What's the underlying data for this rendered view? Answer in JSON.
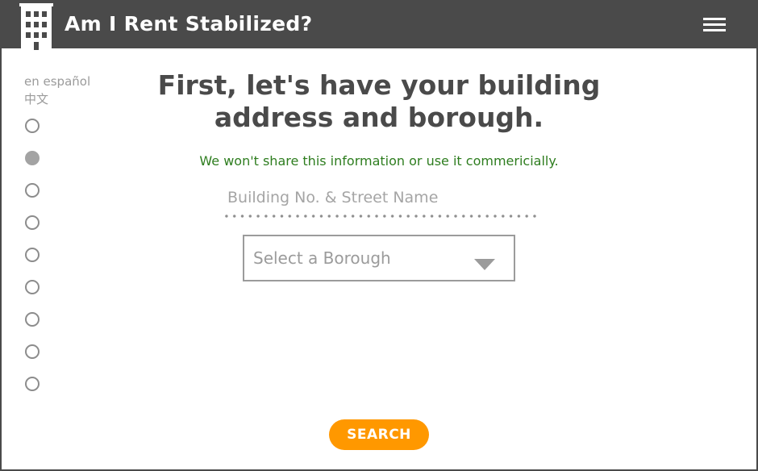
{
  "header": {
    "app_title": "Am I Rent Stabilized?",
    "logo_icon": "building-icon",
    "menu_icon": "hamburger-menu-icon"
  },
  "sidebar": {
    "languages": [
      {
        "label": "en español"
      },
      {
        "label": "中文"
      }
    ],
    "steps_total": 9,
    "active_step": 2
  },
  "main": {
    "heading": "First, let's have your building address and borough.",
    "privacy_note": "We won't share this information or use it commericially.",
    "address_field": {
      "placeholder": "Building No. & Street Name",
      "value": ""
    },
    "borough_select": {
      "selected_label": "Select a Borough",
      "icon": "chevron-down-icon"
    },
    "search_label": "SEARCH"
  },
  "colors": {
    "header_bg": "#4a4a4a",
    "accent_button": "#ff9800",
    "privacy_text": "#2e7d1f",
    "heading_text": "#4a4a4a",
    "muted_gray": "#9b9b9b"
  }
}
